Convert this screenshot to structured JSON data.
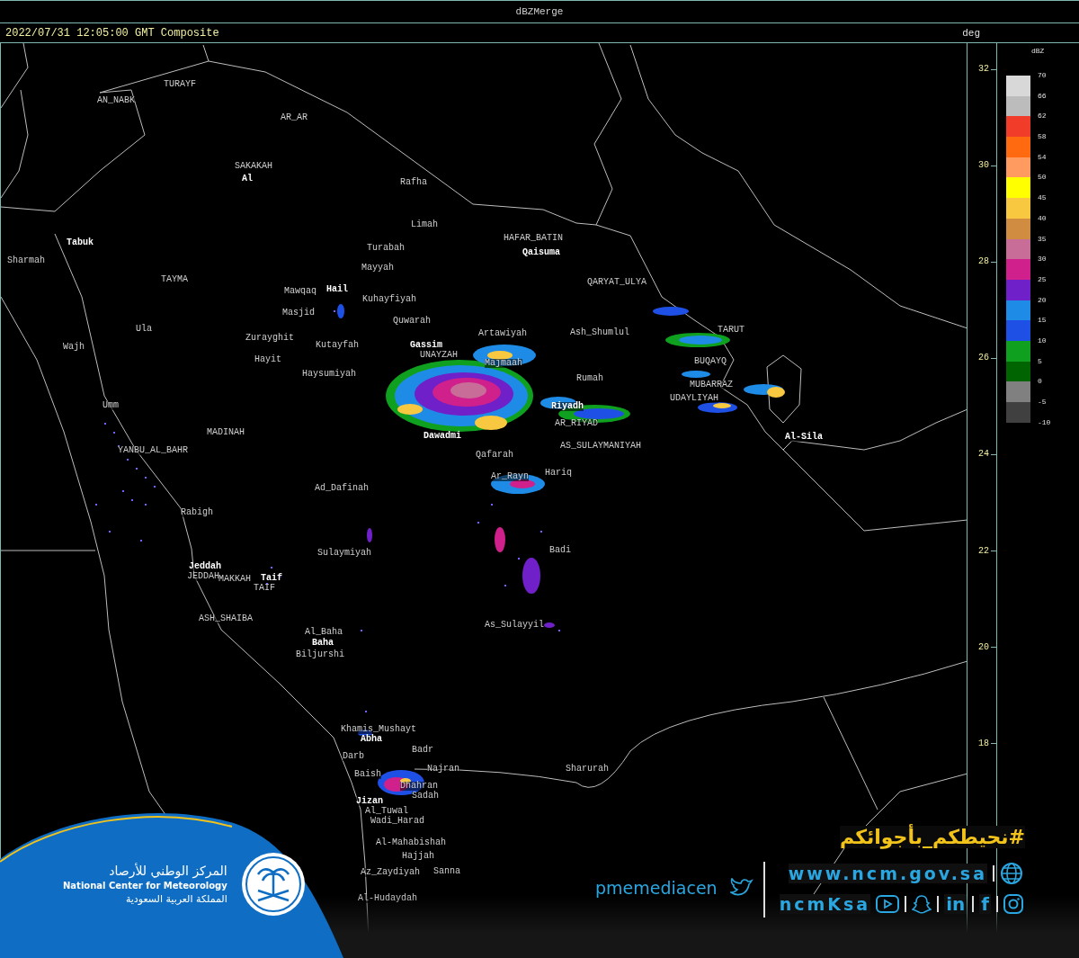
{
  "window": {
    "title": "dBZMerge"
  },
  "header": {
    "timestamp": "2022/07/31 12:05:00 GMT Composite",
    "axis_unit": "deg"
  },
  "latitude_ticks": [
    "32",
    "30",
    "28",
    "26",
    "24",
    "22",
    "20",
    "18"
  ],
  "legend": {
    "unit": "dBZ",
    "bands": [
      {
        "color": "#d8d8d8"
      },
      {
        "color": "#bcbcbc"
      },
      {
        "color": "#f03c28"
      },
      {
        "color": "#ff6a10"
      },
      {
        "color": "#ff9a60"
      },
      {
        "color": "#ffff00"
      },
      {
        "color": "#f8c840"
      },
      {
        "color": "#d08c40"
      },
      {
        "color": "#c86c98"
      },
      {
        "color": "#d0208c"
      },
      {
        "color": "#7020c8"
      },
      {
        "color": "#1e8ce6"
      },
      {
        "color": "#1e50e6"
      },
      {
        "color": "#10a020"
      },
      {
        "color": "#006400"
      },
      {
        "color": "#808080"
      },
      {
        "color": "#404040"
      }
    ],
    "labels": [
      "70",
      "66",
      "62",
      "58",
      "54",
      "50",
      "45",
      "40",
      "35",
      "30",
      "25",
      "20",
      "15",
      "10",
      "5",
      "0",
      "-5",
      "-10"
    ]
  },
  "places": [
    {
      "name": "AN_NABK",
      "kind": "minor"
    },
    {
      "name": "TURAYF",
      "kind": "minor"
    },
    {
      "name": "AR_AR",
      "kind": "minor"
    },
    {
      "name": "SAKAKAH",
      "kind": "minor"
    },
    {
      "name": "Al",
      "kind": "major"
    },
    {
      "name": "Rafha",
      "kind": "minor"
    },
    {
      "name": "Limah",
      "kind": "minor"
    },
    {
      "name": "Turabah",
      "kind": "minor"
    },
    {
      "name": "HAFAR_BATIN",
      "kind": "minor"
    },
    {
      "name": "Qaisuma",
      "kind": "major"
    },
    {
      "name": "Tabuk",
      "kind": "major"
    },
    {
      "name": "Sharmah",
      "kind": "minor"
    },
    {
      "name": "Mayyah",
      "kind": "minor"
    },
    {
      "name": "TAYMA",
      "kind": "minor"
    },
    {
      "name": "Mawqaq",
      "kind": "minor"
    },
    {
      "name": "Hail",
      "kind": "major"
    },
    {
      "name": "Kuhayfiyah",
      "kind": "minor"
    },
    {
      "name": "Masjid",
      "kind": "minor"
    },
    {
      "name": "QARYAT_ULYA",
      "kind": "minor"
    },
    {
      "name": "Quwarah",
      "kind": "minor"
    },
    {
      "name": "Ula",
      "kind": "minor"
    },
    {
      "name": "Artawiyah",
      "kind": "minor"
    },
    {
      "name": "Ash_Shumlul",
      "kind": "minor"
    },
    {
      "name": "Zurayghit",
      "kind": "minor"
    },
    {
      "name": "Wajh",
      "kind": "minor"
    },
    {
      "name": "Kutayfah",
      "kind": "minor"
    },
    {
      "name": "Gassim",
      "kind": "major"
    },
    {
      "name": "UNAYZAH",
      "kind": "minor"
    },
    {
      "name": "Hayit",
      "kind": "minor"
    },
    {
      "name": "Majmaah",
      "kind": "minor"
    },
    {
      "name": "TARUT",
      "kind": "minor"
    },
    {
      "name": "Haysumiyah",
      "kind": "minor"
    },
    {
      "name": "BUQAYQ",
      "kind": "minor"
    },
    {
      "name": "Rumah",
      "kind": "minor"
    },
    {
      "name": "MUBARRAZ",
      "kind": "minor"
    },
    {
      "name": "UDAYLIYAH",
      "kind": "minor"
    },
    {
      "name": "Riyadh",
      "kind": "major"
    },
    {
      "name": "AR_RIYAD",
      "kind": "minor"
    },
    {
      "name": "Umm",
      "kind": "minor"
    },
    {
      "name": "MADINAH",
      "kind": "minor"
    },
    {
      "name": "Dawadmi",
      "kind": "major"
    },
    {
      "name": "Al-Sila",
      "kind": "major"
    },
    {
      "name": "AS_SULAYMANIYAH",
      "kind": "minor"
    },
    {
      "name": "YANBU_AL_BAHR",
      "kind": "minor"
    },
    {
      "name": "Qafarah",
      "kind": "minor"
    },
    {
      "name": "Hariq",
      "kind": "minor"
    },
    {
      "name": "Ar_Rayn",
      "kind": "minor"
    },
    {
      "name": "Ad_Dafinah",
      "kind": "minor"
    },
    {
      "name": "Rabigh",
      "kind": "minor"
    },
    {
      "name": "Badi",
      "kind": "minor"
    },
    {
      "name": "Sulaymiyah",
      "kind": "minor"
    },
    {
      "name": "Jeddah",
      "kind": "major"
    },
    {
      "name": "JEDDAH",
      "kind": "minor"
    },
    {
      "name": "MAKKAH",
      "kind": "minor"
    },
    {
      "name": "Taif",
      "kind": "major"
    },
    {
      "name": "TAIF",
      "kind": "minor"
    },
    {
      "name": "ASH_SHAIBA",
      "kind": "minor"
    },
    {
      "name": "As_Sulayyil",
      "kind": "minor"
    },
    {
      "name": "Al_Baha",
      "kind": "minor"
    },
    {
      "name": "Baha",
      "kind": "major"
    },
    {
      "name": "Biljurshi",
      "kind": "minor"
    },
    {
      "name": "Khamis_Mushayt",
      "kind": "minor"
    },
    {
      "name": "Abha",
      "kind": "major"
    },
    {
      "name": "Badr",
      "kind": "minor"
    },
    {
      "name": "Darb",
      "kind": "minor"
    },
    {
      "name": "Najran",
      "kind": "minor"
    },
    {
      "name": "Sharurah",
      "kind": "minor"
    },
    {
      "name": "Baish",
      "kind": "minor"
    },
    {
      "name": "Dhahran",
      "kind": "minor"
    },
    {
      "name": "Sadah",
      "kind": "minor"
    },
    {
      "name": "Jizan",
      "kind": "major"
    },
    {
      "name": "Al_Tuwal",
      "kind": "minor"
    },
    {
      "name": "Wadi_Harad",
      "kind": "minor"
    },
    {
      "name": "Al-Mahabishah",
      "kind": "minor"
    },
    {
      "name": "Hajjah",
      "kind": "minor"
    },
    {
      "name": "Az_Zaydiyah",
      "kind": "minor"
    },
    {
      "name": "Sanna",
      "kind": "minor"
    },
    {
      "name": "Al-Hudaydah",
      "kind": "minor"
    }
  ],
  "branding": {
    "arabic_name": "المركز الوطني للأرصاد",
    "english_name": "National Center for Meteorology",
    "kingdom": "المملكة العربية السعودية",
    "hashtag": "#نحيطكم_بأجوائكم",
    "website": "www.ncm.gov.sa",
    "social_handle": "ncmKsa",
    "twitter_handle": "pmemediacen",
    "linkedin_mark": "in",
    "facebook_mark": "f"
  }
}
